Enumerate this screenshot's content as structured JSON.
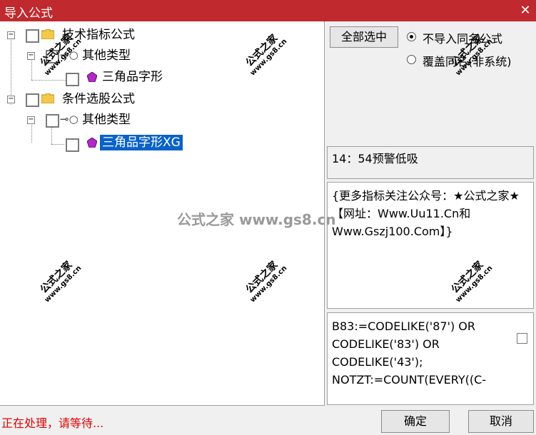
{
  "window": {
    "title": "导入公式",
    "close_glyph": "✕"
  },
  "tree": {
    "technical": {
      "label": "技术指标公式",
      "expander": "−"
    },
    "technical_other": {
      "label": "其他类型",
      "expander": "−"
    },
    "technical_item": {
      "label": "三角品字形"
    },
    "selection": {
      "label": "条件选股公式",
      "expander": "−"
    },
    "selection_other": {
      "label": "其他类型",
      "expander": "−"
    },
    "selection_item": {
      "label": "三角品字形XG"
    }
  },
  "options": {
    "select_all": "全部选中",
    "no_import": "不导入同名公式",
    "overwrite": "覆盖同名(非系统)"
  },
  "info": {
    "time_text": "14：54预警低吸"
  },
  "description": "{更多指标关注公众号：★公式之家★【网址：Www.Uu11.Cn和Www.Gszj100.Com】}",
  "code_lines": [
    "B83:=CODELIKE('87') OR",
    "CODELIKE('83') OR",
    "CODELIKE('43');",
    "NOTZT:=COUNT(EVERY((C-"
  ],
  "status": "正在处理，请等待...",
  "buttons": {
    "ok": "确定",
    "cancel": "取消"
  },
  "watermark": {
    "main": "公式之家",
    "sub": "www.gs8.cn",
    "center": "公式之家 www.gs8.cn"
  },
  "colors": {
    "titlebar": "#c0292d",
    "selection": "#0a62c9",
    "status": "#e00000"
  }
}
